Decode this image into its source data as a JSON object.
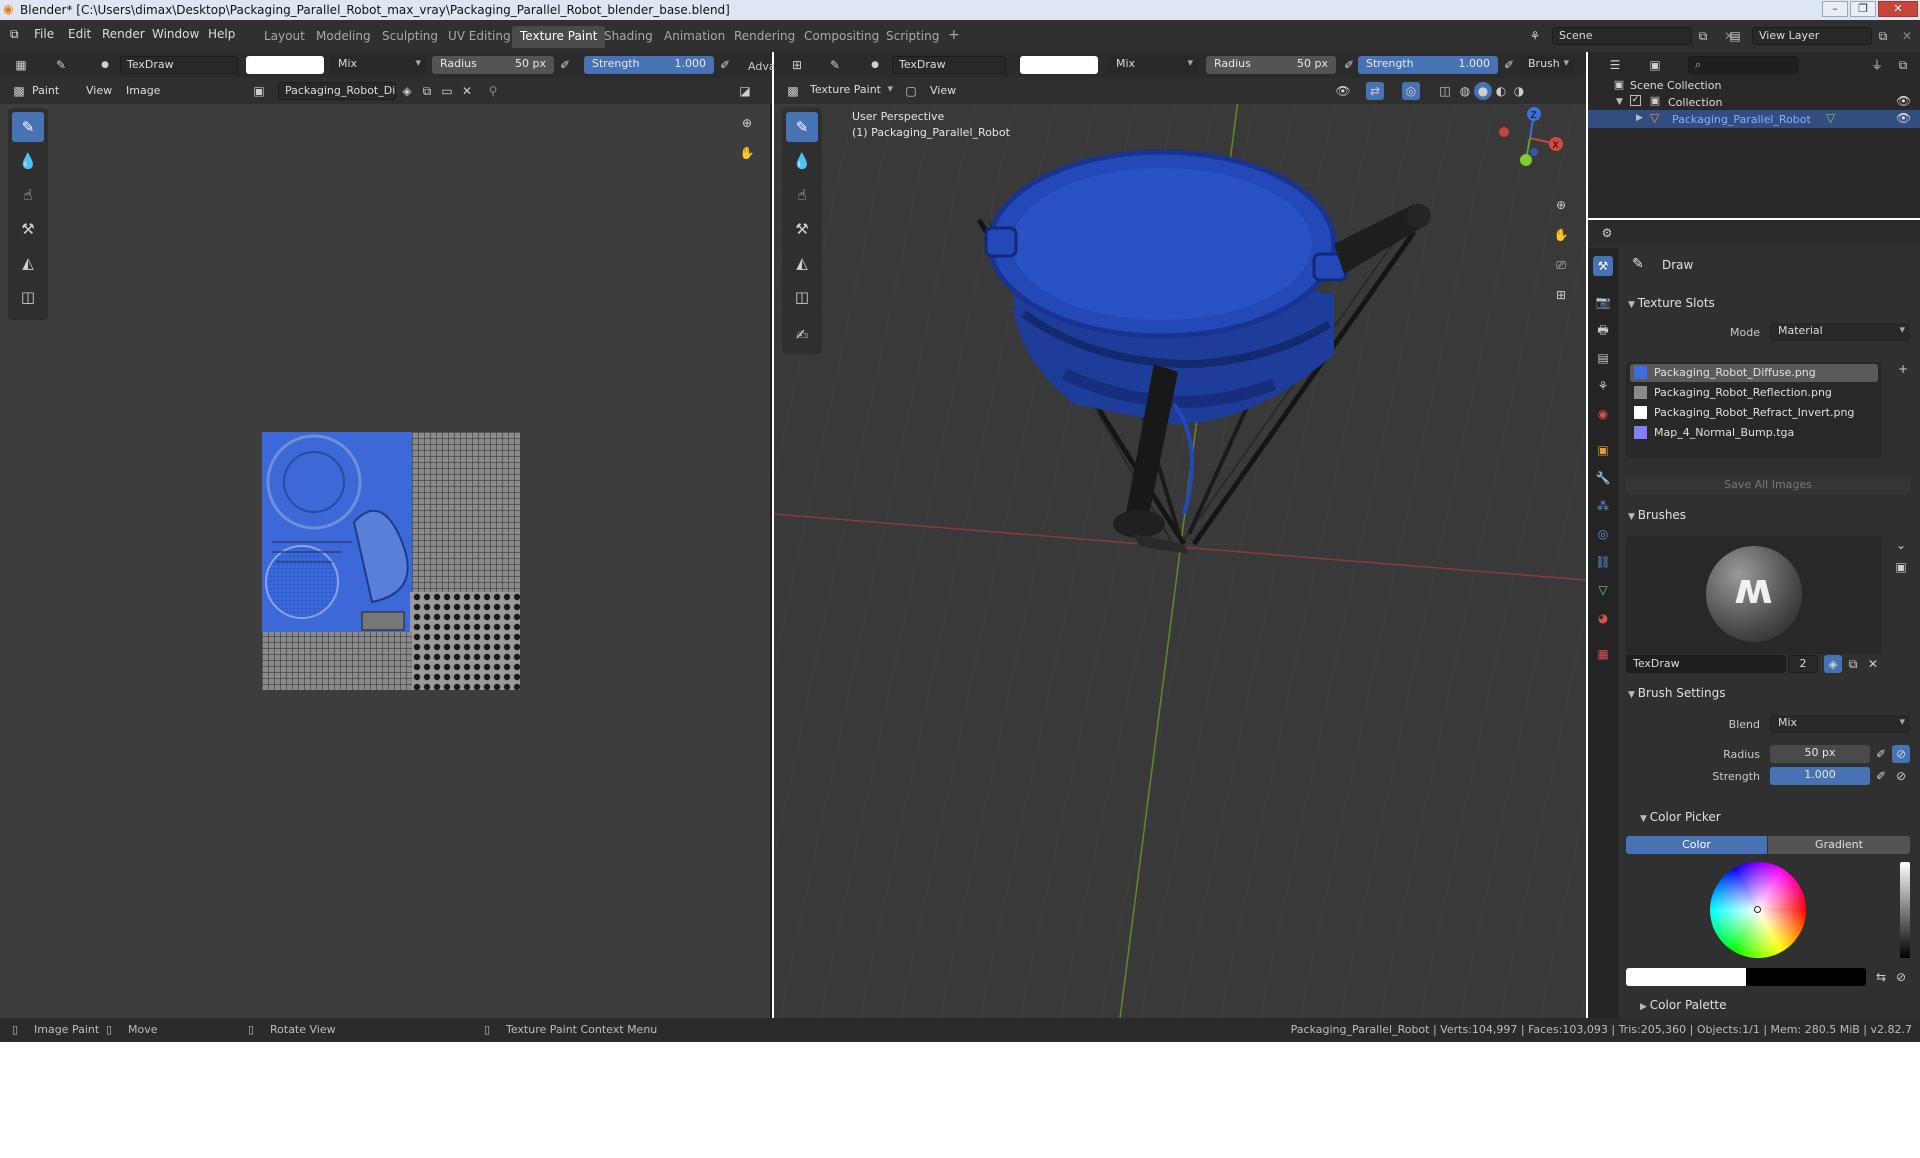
{
  "window": {
    "title": "Blender* [C:\\Users\\dimax\\Desktop\\Packaging_Parallel_Robot_max_vray\\Packaging_Parallel_Robot_blender_base.blend]",
    "controls": [
      "–",
      "❐",
      "✕"
    ]
  },
  "menu": {
    "items": [
      "File",
      "Edit",
      "Render",
      "Window",
      "Help"
    ]
  },
  "workspaces": {
    "tabs": [
      "Layout",
      "Modeling",
      "Sculpting",
      "UV Editing",
      "Texture Paint",
      "Shading",
      "Animation",
      "Rendering",
      "Compositing",
      "Scripting"
    ],
    "active": "Texture Paint",
    "add": "+"
  },
  "scene": {
    "label": "Scene",
    "view_layer": "View Layer"
  },
  "image_editor": {
    "brush_name": "TexDraw",
    "blend": "Mix",
    "radius_label": "Radius",
    "radius_value": "50 px",
    "strength_label": "Strength",
    "strength_value": "1.000",
    "adv": "Adva",
    "mode": "Paint",
    "menu_view": "View",
    "menu_image": "Image",
    "image_name": "Packaging_Robot_Di..."
  },
  "viewport": {
    "brush_name": "TexDraw",
    "blend": "Mix",
    "radius_label": "Radius",
    "radius_value": "50 px",
    "strength_label": "Strength",
    "strength_value": "1.000",
    "brush_menu": "Brush",
    "mode": "Texture Paint",
    "menu_view": "View",
    "overlay_line1": "User Perspective",
    "overlay_line2": "(1) Packaging_Parallel_Robot",
    "gizmo": {
      "z": "Z",
      "x": "X",
      "y": "Y"
    }
  },
  "outliner": {
    "root": "Scene Collection",
    "collection": "Collection",
    "object": "Packaging_Parallel_Robot"
  },
  "properties": {
    "tool_name": "Draw",
    "texture_slots": {
      "header": "Texture Slots",
      "mode_label": "Mode",
      "mode_value": "Material",
      "slots": [
        {
          "name": "Packaging_Robot_Diffuse.png",
          "color": "#3c6ee0"
        },
        {
          "name": "Packaging_Robot_Reflection.png",
          "color": "#8a8a8a"
        },
        {
          "name": "Packaging_Robot_Refract_Invert.png",
          "color": "#ffffff"
        },
        {
          "name": "Map_4_Normal_Bump.tga",
          "color": "#8080ff"
        }
      ],
      "save_all": "Save All Images"
    },
    "brushes": {
      "header": "Brushes",
      "name": "TexDraw",
      "users": "2"
    },
    "brush_settings": {
      "header": "Brush Settings",
      "blend_label": "Blend",
      "blend_value": "Mix",
      "radius_label": "Radius",
      "radius_value": "50 px",
      "strength_label": "Strength",
      "strength_value": "1.000"
    },
    "color_picker": {
      "header": "Color Picker",
      "tab_color": "Color",
      "tab_gradient": "Gradient"
    },
    "color_palette": {
      "header": "Color Palette"
    }
  },
  "status": {
    "image_paint": "Image Paint",
    "move": "Move",
    "rotate": "Rotate View",
    "context": "Texture Paint Context Menu",
    "stats": "Packaging_Parallel_Robot | Verts:104,997 | Faces:103,093 | Tris:205,360 | Objects:1/1 | Mem: 280.5 MiB | v2.82.7"
  },
  "colors": {
    "accent": "#4772b3",
    "robot_blue": "#2448b8",
    "x_axis": "#a33c3c",
    "y_axis": "#6b9a2a",
    "z_axis": "#3a72d8"
  }
}
